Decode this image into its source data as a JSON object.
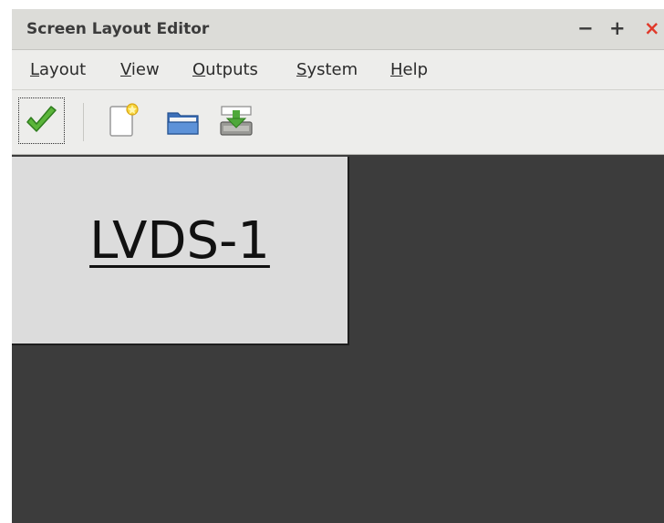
{
  "window": {
    "title": "Screen Layout Editor",
    "controls": {
      "minimize": "−",
      "maximize": "+",
      "close": "×"
    }
  },
  "menubar": {
    "items": [
      {
        "mnemonic": "L",
        "rest": "ayout"
      },
      {
        "mnemonic": "V",
        "rest": "iew"
      },
      {
        "mnemonic": "O",
        "rest": "utputs"
      },
      {
        "mnemonic": "S",
        "rest": "ystem"
      },
      {
        "mnemonic": "H",
        "rest": "elp"
      }
    ]
  },
  "toolbar": {
    "icons": [
      "checkmark-icon",
      "new-document-icon",
      "folder-open-icon",
      "save-icon"
    ]
  },
  "canvas": {
    "outputs": [
      {
        "name": "LVDS-1"
      }
    ]
  },
  "colors": {
    "canvas_bg": "#3c3c3c",
    "output_bg": "#dcdcdc",
    "close_red": "#e0392a",
    "check_green": "#5bb53a"
  }
}
